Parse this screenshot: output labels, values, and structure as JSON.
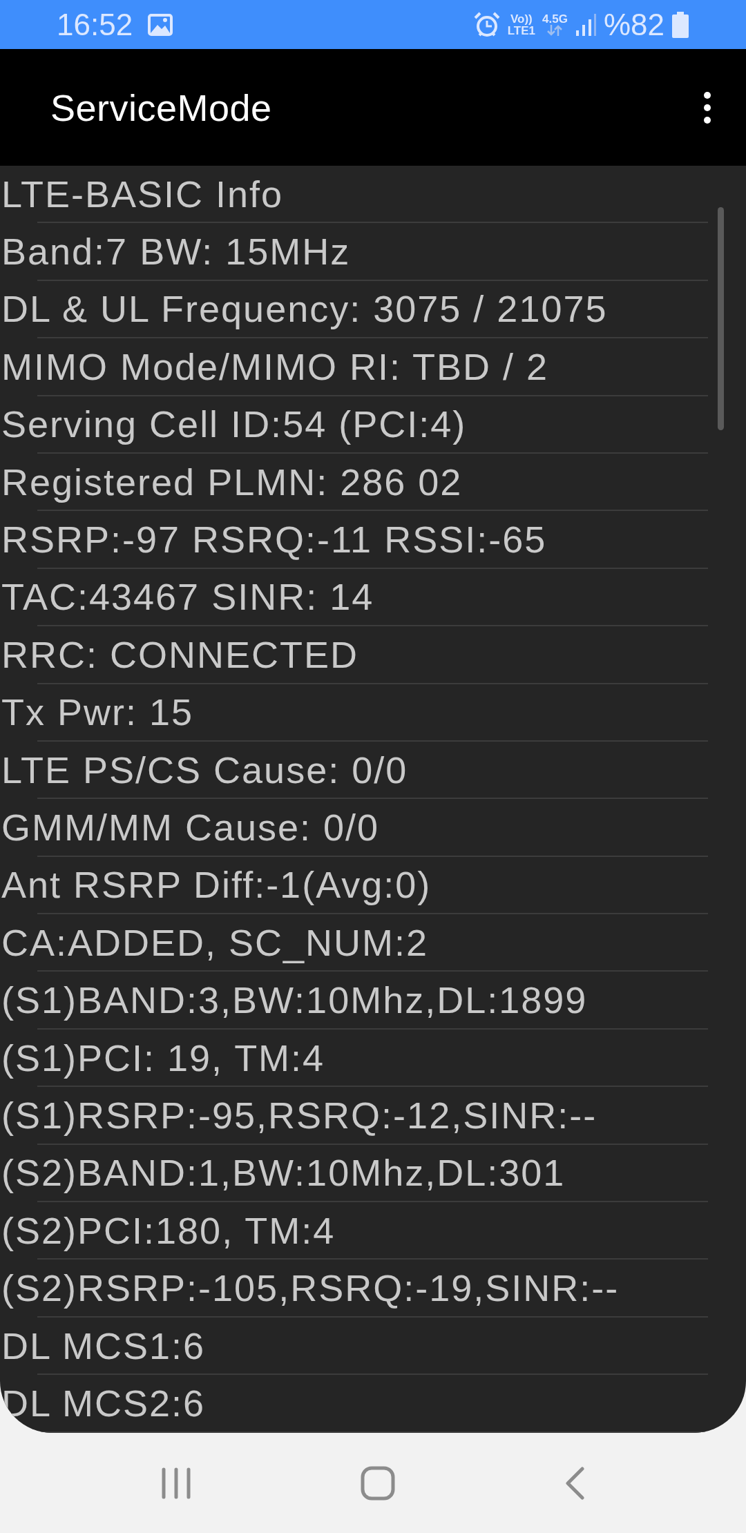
{
  "status_bar": {
    "time": "16:52",
    "volte": "Vo))",
    "network": "LTE1",
    "generation": "4.5G",
    "battery": "%82"
  },
  "app_bar": {
    "title": "ServiceMode"
  },
  "lines": [
    "LTE-BASIC Info",
    "Band:7 BW: 15MHz",
    "DL & UL Frequency: 3075 / 21075",
    "MIMO Mode/MIMO RI: TBD / 2",
    "Serving Cell ID:54 (PCI:4)",
    "Registered PLMN: 286 02",
    "RSRP:-97 RSRQ:-11 RSSI:-65",
    "TAC:43467 SINR: 14",
    "RRC: CONNECTED",
    "Tx Pwr: 15",
    "LTE PS/CS Cause: 0/0",
    "GMM/MM Cause: 0/0",
    "Ant RSRP Diff:-1(Avg:0)",
    "CA:ADDED, SC_NUM:2",
    "(S1)BAND:3,BW:10Mhz,DL:1899",
    "(S1)PCI: 19, TM:4",
    "(S1)RSRP:-95,RSRQ:-12,SINR:--",
    "(S2)BAND:1,BW:10Mhz,DL:301",
    "(S2)PCI:180, TM:4",
    "(S2)RSRP:-105,RSRQ:-19,SINR:--",
    "DL MCS1:6",
    "DL MCS2:6"
  ]
}
